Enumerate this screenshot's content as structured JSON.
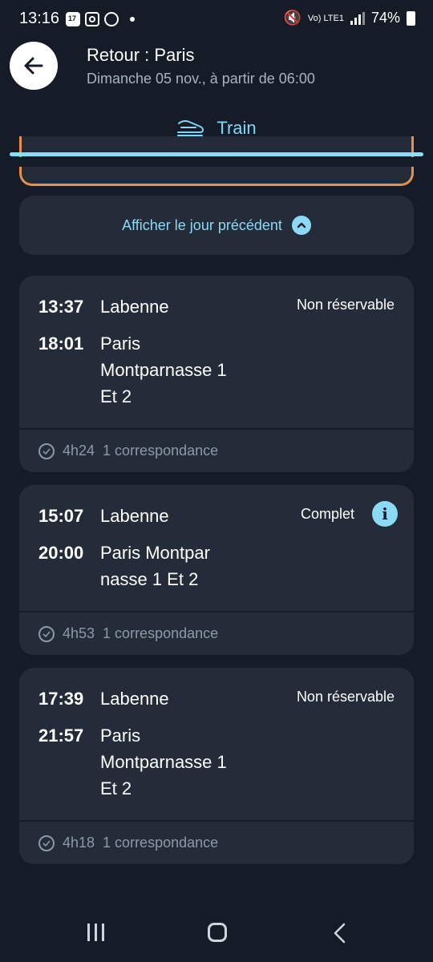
{
  "status_bar": {
    "time": "13:16",
    "calendar_day": "17",
    "network": "Vo) LTE1",
    "battery": "74%"
  },
  "header": {
    "title": "Retour : Paris",
    "subtitle": "Dimanche 05 nov., à partir de 06:00",
    "back_icon": "arrow-left-icon"
  },
  "tab": {
    "label": "Train",
    "icon": "train-icon"
  },
  "show_previous_day": {
    "label": "Afficher le jour précédent",
    "icon": "chevron-up-icon"
  },
  "results": [
    {
      "departure_time": "13:37",
      "departure_station": "Labenne",
      "arrival_time": "18:01",
      "arrival_station_lines": [
        "Paris",
        "Montparnasse 1",
        "Et 2"
      ],
      "status": "Non réservable",
      "duration": "4h24",
      "connections": "1 correspondance"
    },
    {
      "departure_time": "15:07",
      "departure_station": "Labenne",
      "arrival_time": "20:00",
      "arrival_station_lines": [
        "Paris Montpar",
        "nasse 1 Et 2"
      ],
      "status": "Complet",
      "info_icon": "i",
      "duration": "4h53",
      "connections": "1 correspondance"
    },
    {
      "departure_time": "17:39",
      "departure_station": "Labenne",
      "arrival_time": "21:57",
      "arrival_station_lines": [
        "Paris",
        "Montparnasse 1",
        "Et 2"
      ],
      "status": "Non réservable",
      "duration": "4h18",
      "connections": "1 correspondance"
    }
  ],
  "colors": {
    "background": "#151c27",
    "card": "#232c38",
    "accent": "#8bd9f5",
    "highlight_border": "#e6914a",
    "muted_text": "#8e99a8"
  }
}
